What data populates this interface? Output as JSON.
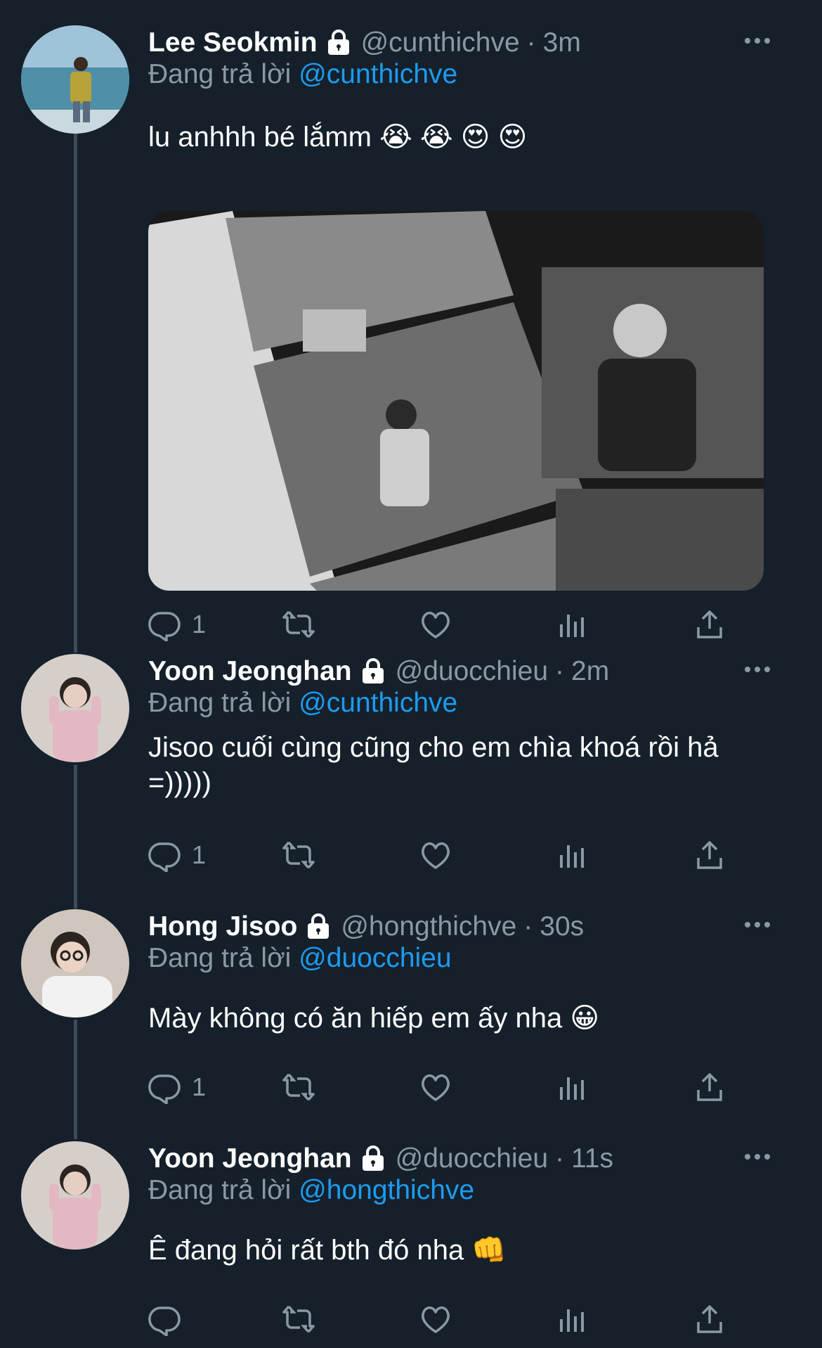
{
  "tweets": [
    {
      "name": "Lee Seokmin",
      "handle": "@cunthichve",
      "dot": "·",
      "time": "3m",
      "reply_prefix": "Đang trả lời",
      "reply_target": "@cunthichve",
      "text": "lu anhhh bé lắmm 😭 😭 😍 😍",
      "reply_count": "1",
      "has_media": true
    },
    {
      "name": "Yoon Jeonghan",
      "handle": "@duocchieu",
      "dot": "·",
      "time": "2m",
      "reply_prefix": "Đang trả lời",
      "reply_target": "@cunthichve",
      "text": "Jisoo cuối cùng cũng cho em chìa khoá rồi hả =)))))",
      "reply_count": "1"
    },
    {
      "name": "Hong Jisoo",
      "handle": "@hongthichve",
      "dot": "·",
      "time": "30s",
      "reply_prefix": "Đang trả lời",
      "reply_target": "@duocchieu",
      "text": "Mày không có ăn hiếp em ấy nha 😀",
      "reply_count": "1"
    },
    {
      "name": "Yoon Jeonghan",
      "handle": "@duocchieu",
      "dot": "·",
      "time": "11s",
      "reply_prefix": "Đang trả lời",
      "reply_target": "@hongthichve",
      "text": "Ê đang hỏi rất bth đó nha 👊",
      "reply_count": ""
    }
  ],
  "icons": {
    "reply": "reply-icon",
    "retweet": "retweet-icon",
    "like": "heart-icon",
    "views": "analytics-icon",
    "share": "share-icon",
    "more": "more-icon",
    "lock": "lock-icon"
  },
  "colors": {
    "background": "#15202b",
    "muted": "#8b98a5",
    "link": "#1d9bf0",
    "thread_line": "#3d4b58"
  }
}
